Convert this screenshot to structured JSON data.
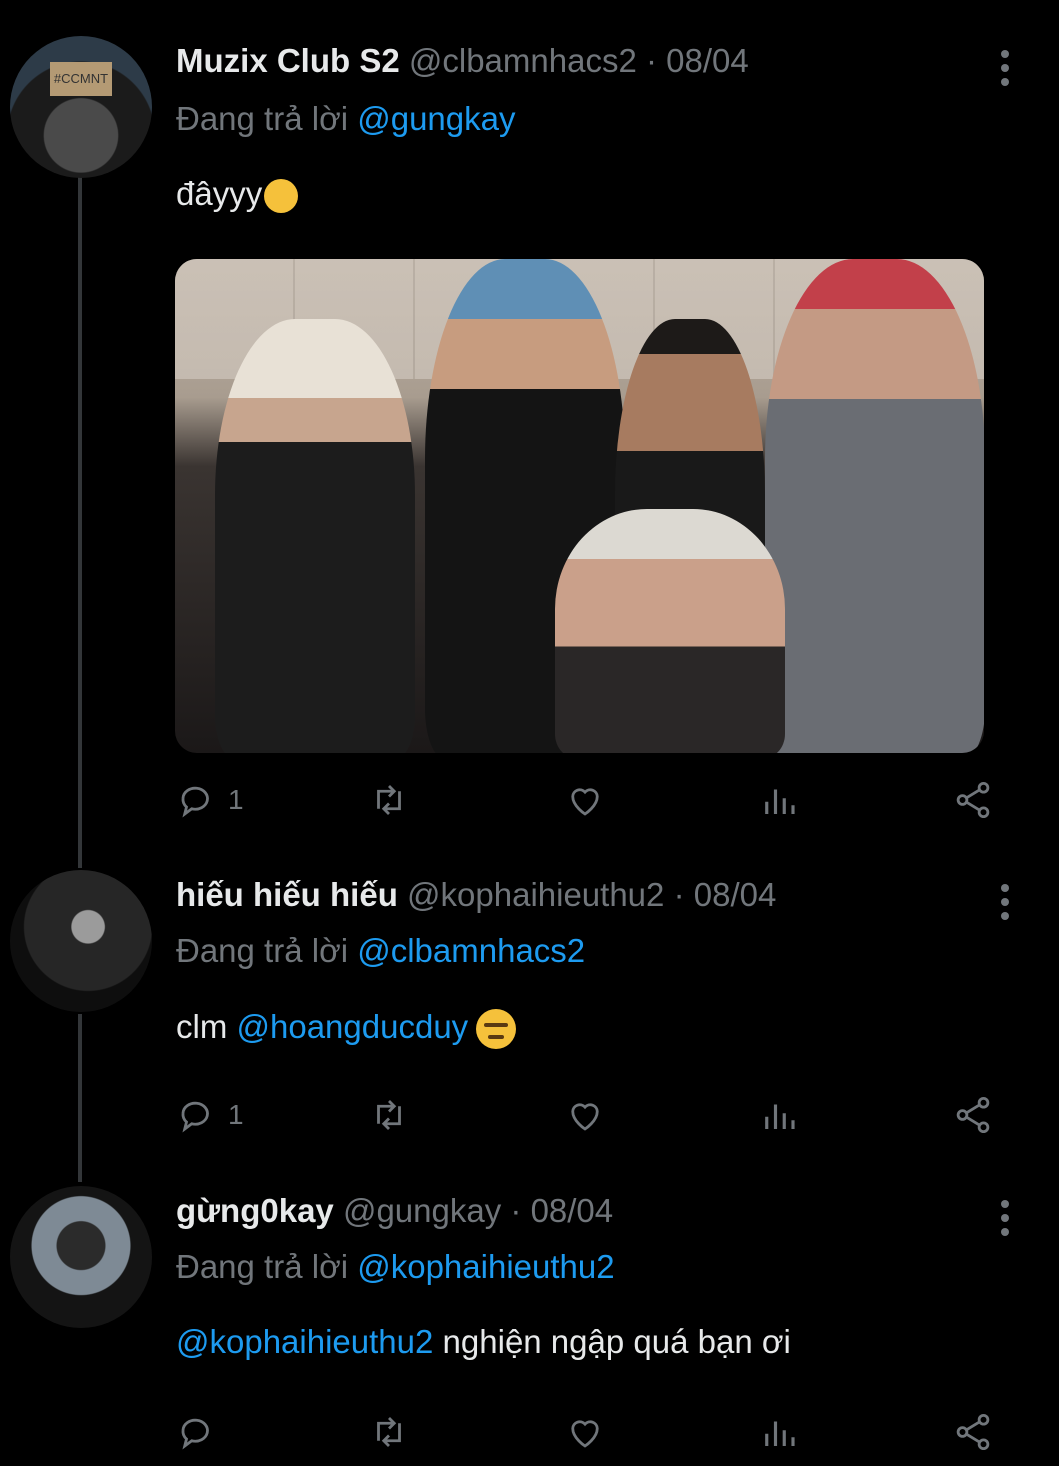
{
  "tweets": [
    {
      "name": "Muzix Club S2",
      "handle": "@clbamnhacs2",
      "separator": "·",
      "date": "08/04",
      "reply_prefix": "Đang trả lời",
      "reply_to": "@gungkay",
      "text": "đâyyy",
      "avatar_sign_text": "#CCMNT",
      "has_image": true,
      "reply_count": "1"
    },
    {
      "name": "hiếu hiếu hiếu",
      "handle": "@kophaihieuthu2",
      "separator": "·",
      "date": "08/04",
      "reply_prefix": "Đang trả lời",
      "reply_to": "@clbamnhacs2",
      "text_prefix": "clm",
      "text_mention": "@hoangducduy",
      "reply_count": "1"
    },
    {
      "name": "gừng0kay",
      "handle": "@gungkay",
      "separator": "·",
      "date": "08/04",
      "reply_prefix": "Đang trả lời",
      "reply_to": "@kophaihieuthu2",
      "text_mention": "@kophaihieuthu2",
      "text_suffix": "nghiện ngập quá bạn ơi",
      "reply_count": ""
    }
  ],
  "icons": [
    "reply-icon",
    "retweet-icon",
    "like-icon",
    "views-icon",
    "share-icon",
    "more-icon"
  ],
  "colors": {
    "background": "#000000",
    "text": "#e7e9ea",
    "muted": "#71767b",
    "accent": "#1d9bf0"
  }
}
